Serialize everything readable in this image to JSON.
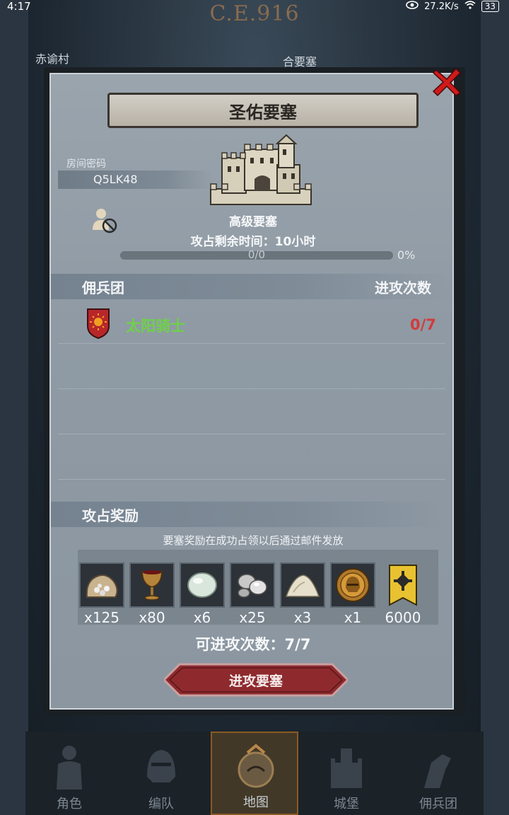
{
  "status_bar": {
    "time": "4:17",
    "network_speed": "27.2K/s",
    "battery": "33"
  },
  "background": {
    "era_label": "C.E.916",
    "town_left": "赤谕村",
    "town_right": "合要塞"
  },
  "dialog": {
    "title": "圣佑要塞",
    "room_label": "房间密码",
    "room_code": "Q5LK48",
    "fort_level": "高级要塞",
    "time_left_label": "攻占剩余时间：",
    "time_left_value": "10小时",
    "progress_text": "0/0",
    "progress_percent": "0%",
    "progress_value": 0,
    "mercenary_header": "佣兵团",
    "attack_count_header": "进攻次数",
    "mercenaries": [
      {
        "name": "太阳骑士",
        "count": "0/7",
        "shield_color": "#b8262a"
      }
    ],
    "rewards_header": "攻占奖励",
    "rewards_note": "要塞奖励在成功占领以后通过邮件发放",
    "rewards": [
      {
        "icon": "stone-sack-icon",
        "qty": "x125"
      },
      {
        "icon": "goblet-icon",
        "qty": "x80"
      },
      {
        "icon": "gem-stone-icon",
        "qty": "x6"
      },
      {
        "icon": "silver-ore-icon",
        "qty": "x25"
      },
      {
        "icon": "sand-pile-icon",
        "qty": "x3"
      },
      {
        "icon": "helmet-medal-icon",
        "qty": "x1"
      },
      {
        "icon": "banner-emblem-icon",
        "qty": "6000"
      }
    ],
    "attacks_available_label": "可进攻次数：",
    "attacks_available_value": "7/7",
    "attack_button": "进攻要塞"
  },
  "bottom_nav": [
    {
      "label": "角色",
      "icon": "knight-icon"
    },
    {
      "label": "编队",
      "icon": "helmet-icon"
    },
    {
      "label": "地图",
      "icon": "map-compass-icon",
      "active": true
    },
    {
      "label": "城堡",
      "icon": "castle-icon"
    },
    {
      "label": "佣兵团",
      "icon": "armored-arm-icon"
    }
  ],
  "colors": {
    "mercenary_name": "#6fd04a",
    "attack_count": "#d23c3c",
    "attack_button": "#8e2a2e",
    "close_x": "#d01a1a"
  }
}
